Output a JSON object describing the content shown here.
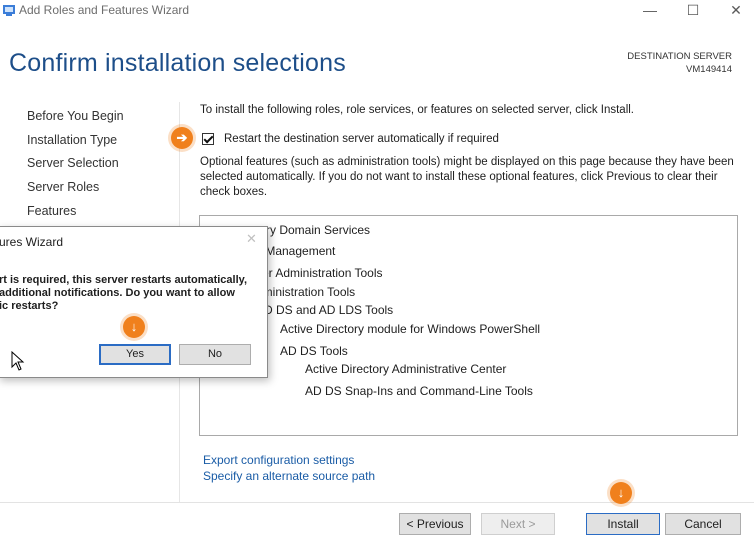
{
  "window": {
    "title": "Add Roles and Features Wizard",
    "controls": {
      "minimize": "—",
      "maximize": "☐",
      "close": "✕"
    }
  },
  "page": {
    "title": "Confirm installation selections",
    "destination_label": "DESTINATION SERVER",
    "destination_value": "VM149414"
  },
  "nav": {
    "items": [
      {
        "label": "Before You Begin"
      },
      {
        "label": "Installation Type"
      },
      {
        "label": "Server Selection"
      },
      {
        "label": "Server Roles"
      },
      {
        "label": "Features"
      }
    ]
  },
  "main": {
    "intro": "To install the following roles, role services, or features on selected server, click Install.",
    "restart_checkbox_label": "Restart the destination server automatically if required",
    "restart_checked": true,
    "optional_text": "Optional features (such as administration tools) might be displayed on this page because they have been selected automatically. If you do not want to install these optional features, click Previous to clear their check boxes.",
    "features": [
      "tory Domain Services",
      "y Management",
      "ver Administration Tools",
      "dministration Tools",
      "D DS and AD LDS Tools",
      "Active Directory module for Windows PowerShell",
      "AD DS Tools",
      "Active Directory Administrative Center",
      "AD DS Snap-Ins and Command-Line Tools"
    ],
    "export_link": "Export configuration settings",
    "alternate_source_link": "Specify an alternate source path"
  },
  "buttons": {
    "previous": "< Previous",
    "next": "Next >",
    "install": "Install",
    "cancel": "Cancel"
  },
  "dialog": {
    "title": "ures Wizard",
    "close": "✕",
    "message": "rt is required, this server restarts automatically,\nadditional notifications. Do you want to allow\nic restarts?",
    "yes": "Yes",
    "no": "No"
  },
  "badges": {
    "right_arrow": "➔",
    "down_arrow": "↓"
  },
  "colors": {
    "title_blue": "#1d4e89",
    "link_blue": "#1a5ca6",
    "badge_orange": "#f0801c"
  }
}
